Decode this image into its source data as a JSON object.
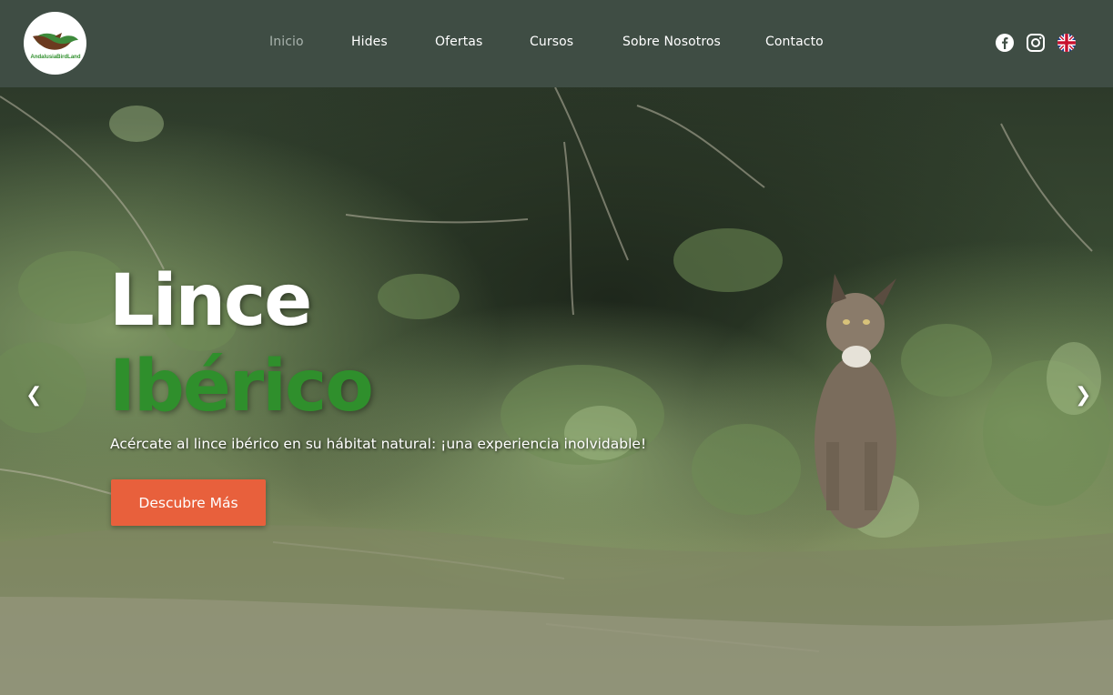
{
  "header": {
    "logo_text": "AndalusiaBirdLand",
    "nav": [
      {
        "label": "Inicio",
        "active": true
      },
      {
        "label": "Hides"
      },
      {
        "label": "Ofertas"
      },
      {
        "label": "Cursos"
      },
      {
        "label": "Sobre Nosotros"
      },
      {
        "label": "Contacto"
      }
    ],
    "social": [
      "facebook-icon",
      "instagram-icon",
      "uk-flag-icon"
    ]
  },
  "hero": {
    "title_line1": "Lince",
    "title_line2": "Ibérico",
    "subtitle": "Acércate al lince ibérico en su hábitat natural: ¡una experiencia inolvidable!",
    "cta_label": "Descubre Más",
    "prev_arrow": "❮",
    "next_arrow": "❯"
  },
  "colors": {
    "header_bg": "#3f4d44",
    "accent_green": "#2f8f2c",
    "cta_orange": "#e8603c",
    "active_nav": "#a9b3ad"
  }
}
